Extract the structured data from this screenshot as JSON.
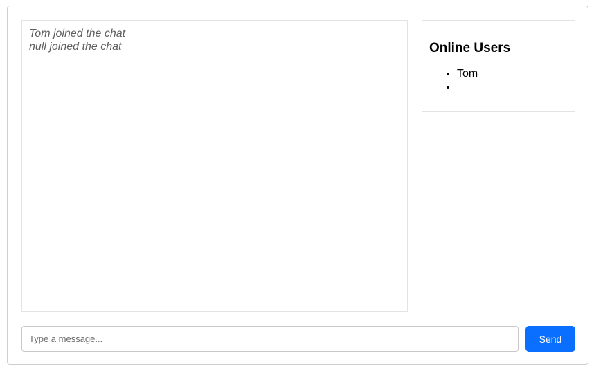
{
  "messages": [
    {
      "text": "Tom joined the chat"
    },
    {
      "text": "null joined the chat"
    }
  ],
  "online_users": {
    "title": "Online Users",
    "users": [
      "Tom",
      ""
    ]
  },
  "composer": {
    "placeholder": "Type a message...",
    "value": "",
    "send_label": "Send"
  },
  "colors": {
    "accent": "#0a6fff",
    "system_message_text": "#5f5f5f",
    "border": "#cfcfcf"
  }
}
